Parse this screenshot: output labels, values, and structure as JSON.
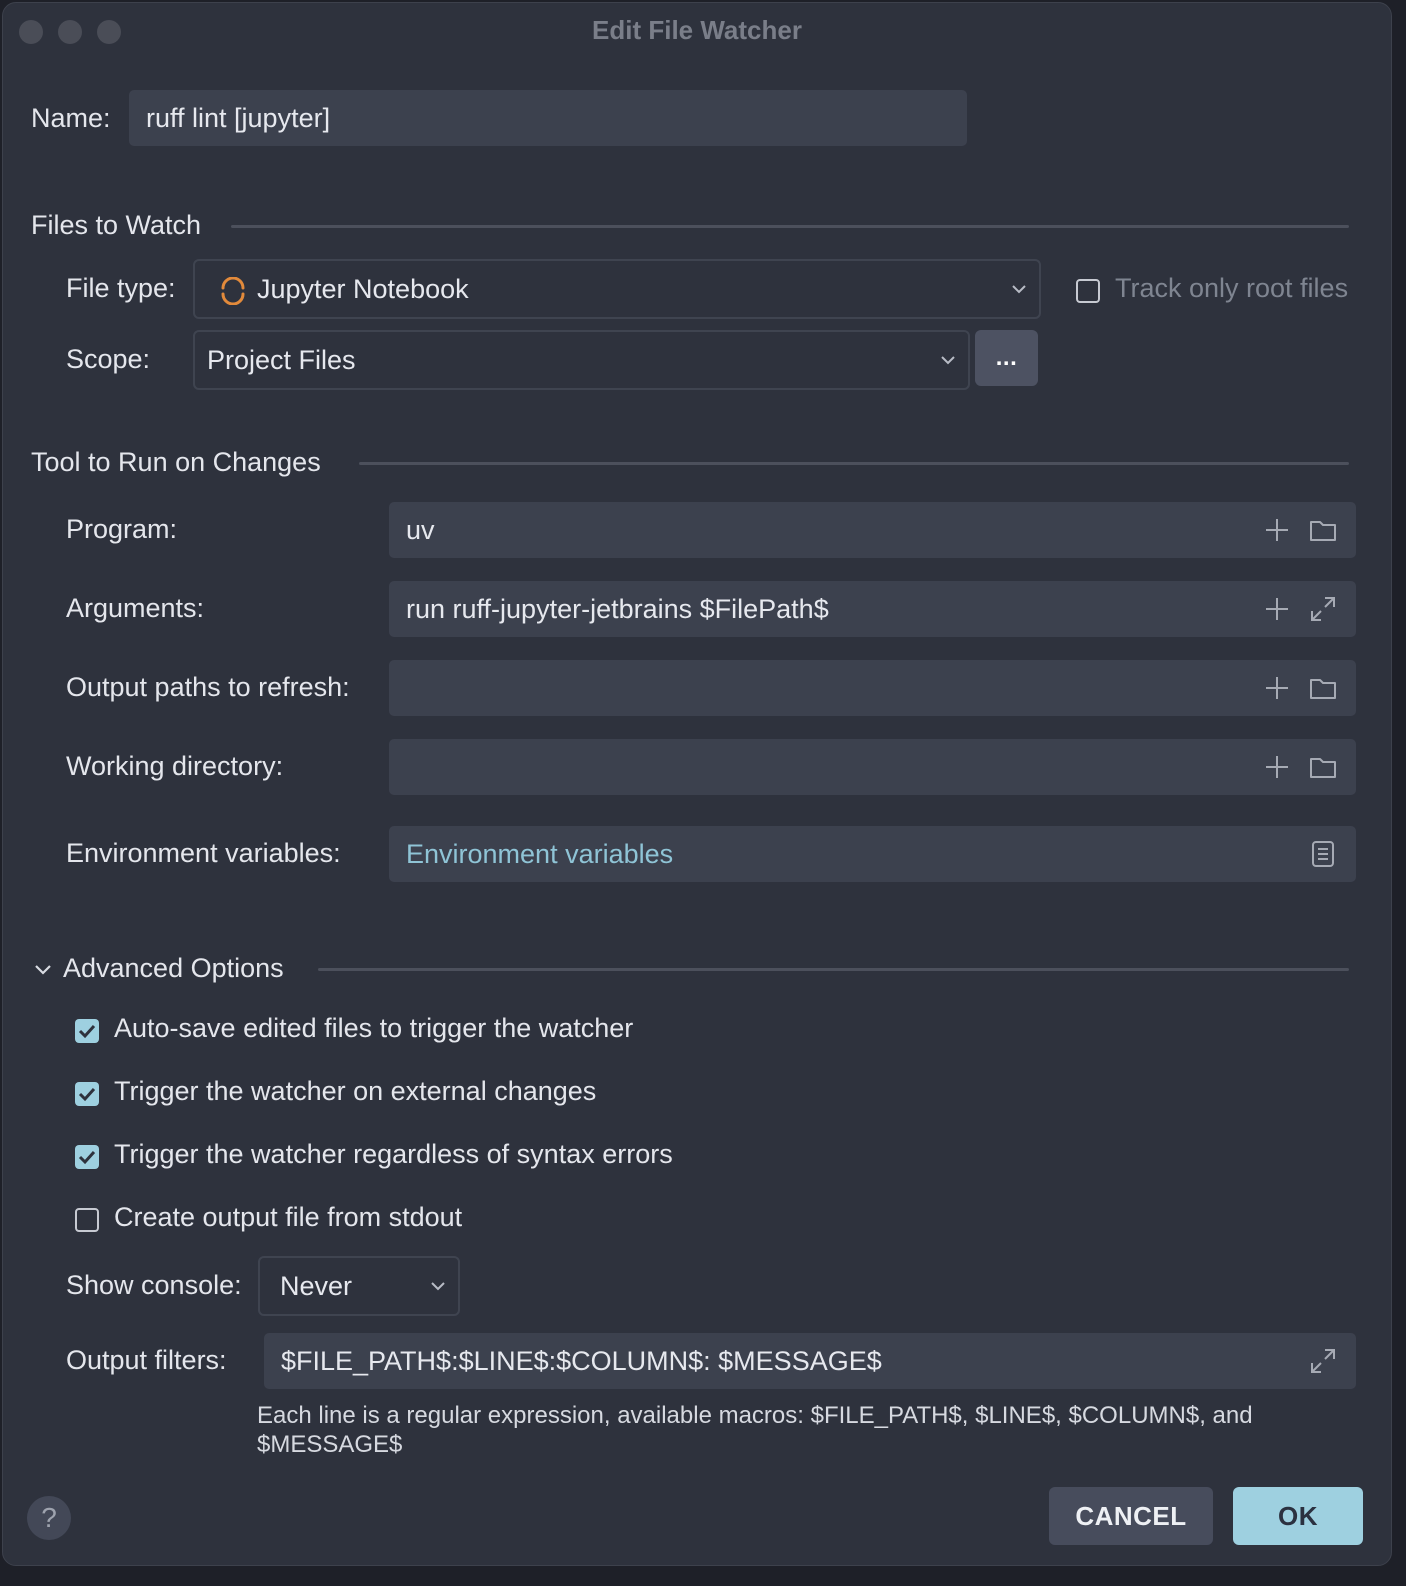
{
  "window": {
    "title": "Edit File Watcher"
  },
  "name": {
    "label": "Name:",
    "value": "ruff lint [jupyter]"
  },
  "files_to_watch": {
    "heading": "Files to Watch",
    "file_type_label": "File type:",
    "file_type_value": "Jupyter Notebook",
    "track_only_root_label": "Track only root files",
    "track_only_root_checked": false,
    "scope_label": "Scope:",
    "scope_value": "Project Files",
    "scope_browse_label": "..."
  },
  "tool": {
    "heading": "Tool to Run on Changes",
    "program_label": "Program:",
    "program_value": "uv",
    "arguments_label": "Arguments:",
    "arguments_value": "run ruff-jupyter-jetbrains $FilePath$",
    "output_paths_label": "Output paths to refresh:",
    "output_paths_value": "",
    "working_dir_label": "Working directory:",
    "working_dir_value": "",
    "env_label": "Environment variables:",
    "env_placeholder": "Environment variables"
  },
  "advanced": {
    "heading": "Advanced Options",
    "options": [
      {
        "label": "Auto-save edited files to trigger the watcher",
        "checked": true
      },
      {
        "label": "Trigger the watcher on external changes",
        "checked": true
      },
      {
        "label": "Trigger the watcher regardless of syntax errors",
        "checked": true
      },
      {
        "label": "Create output file from stdout",
        "checked": false
      }
    ],
    "show_console_label": "Show console:",
    "show_console_value": "Never",
    "output_filters_label": "Output filters:",
    "output_filters_value": "$FILE_PATH$:$LINE$:$COLUMN$: $MESSAGE$",
    "hint_line1": "Each line is a regular expression, available macros: $FILE_PATH$, $LINE$, $COLUMN$, and",
    "hint_line2": "$MESSAGE$"
  },
  "footer": {
    "help_label": "?",
    "cancel_label": "CANCEL",
    "ok_label": "OK"
  },
  "colors": {
    "accent": "#9ed0e0",
    "link": "#8fc4d6",
    "background": "#2e323d",
    "field": "#3c414e"
  }
}
